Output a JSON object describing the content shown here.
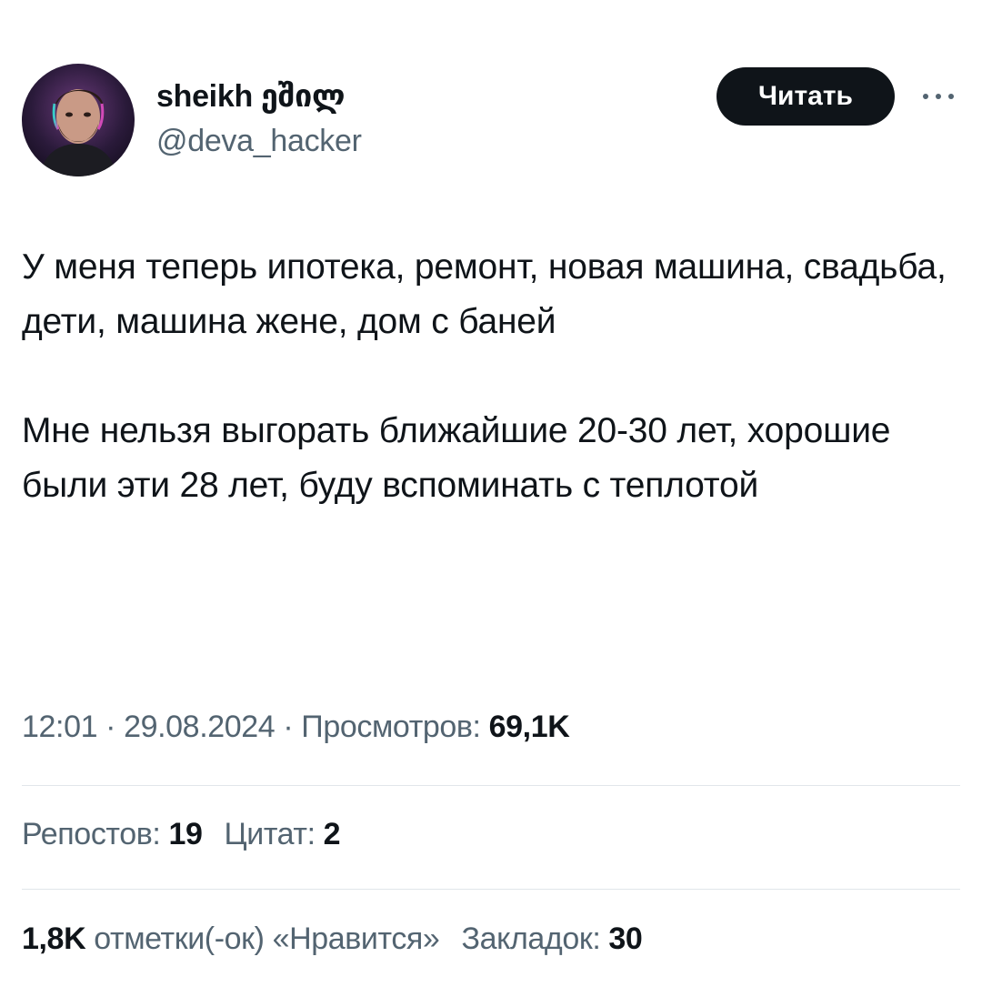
{
  "author": {
    "display_name": "sheikh ეშილ",
    "handle": "@deva_hacker"
  },
  "follow_button": {
    "label": "Читать"
  },
  "tweet": {
    "paragraphs": [
      "У меня теперь ипотека, ремонт, новая машина, свадьба, дети, машина жене, дом с баней",
      "Мне нельзя выгорать ближайшие 20-30 лет, хорошие были эти 28 лет, буду вспоминать с теплотой"
    ]
  },
  "meta": {
    "time": "12:01",
    "separator": " · ",
    "date": "29.08.2024",
    "views_label": "Просмотров: ",
    "views_value": "69,1K"
  },
  "stats": {
    "reposts_label": "Репостов: ",
    "reposts_value": "19",
    "quotes_label": "Цитат: ",
    "quotes_value": "2",
    "likes_value": "1,8K",
    "likes_label": " отметки(-ок) «Нравится»",
    "bookmarks_label": "Закладок: ",
    "bookmarks_value": "30"
  },
  "icons": {
    "more": "more-dots-icon",
    "avatar": "avatar-photo"
  },
  "colors": {
    "text": "#0f1419",
    "secondary": "#536471",
    "button_bg": "#0f1419",
    "divider": "#e1e6ea"
  }
}
